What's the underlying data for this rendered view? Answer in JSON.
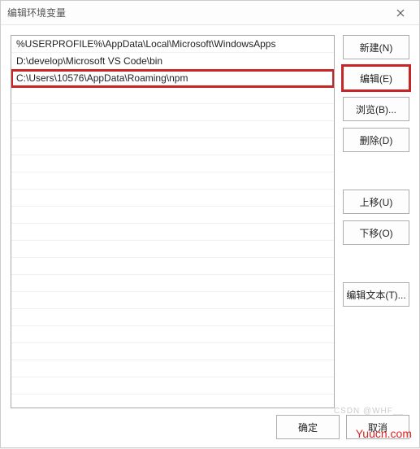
{
  "title": "编辑环境变量",
  "list_items": [
    "%USERPROFILE%\\AppData\\Local\\Microsoft\\WindowsApps",
    "D:\\develop\\Microsoft VS Code\\bin",
    "C:\\Users\\10576\\AppData\\Roaming\\npm"
  ],
  "highlighted_index": 2,
  "buttons": {
    "new": "新建(N)",
    "edit": "编辑(E)",
    "browse": "浏览(B)...",
    "delete": "删除(D)",
    "moveup": "上移(U)",
    "movedown": "下移(O)",
    "edittext": "编辑文本(T)..."
  },
  "footer": {
    "ok": "确定",
    "cancel": "取消"
  },
  "watermarks": {
    "csdn": "CSDN @WHF__",
    "site": "Yuucn.com"
  }
}
